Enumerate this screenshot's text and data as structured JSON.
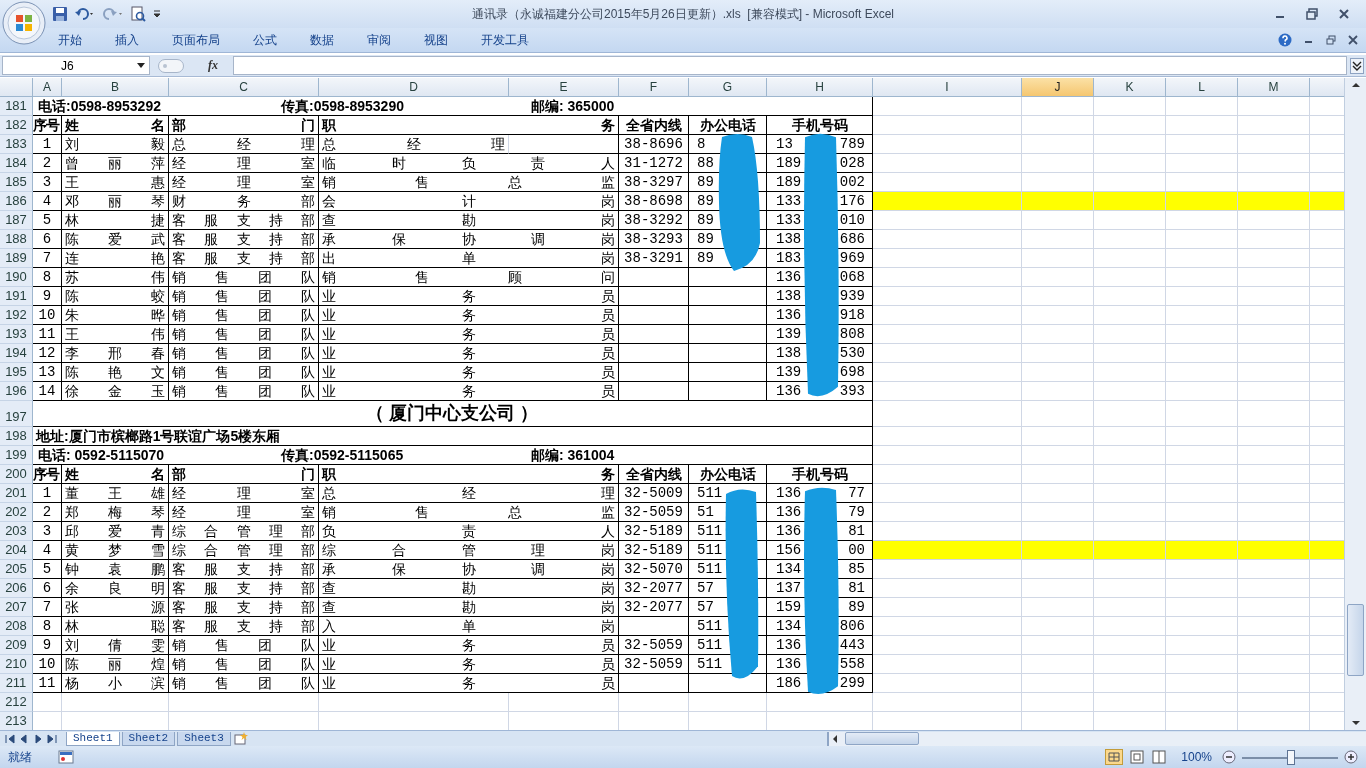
{
  "window": {
    "title": "通讯录（永诚福建分公司2015年5月26日更新）.xls  [兼容模式] - Microsoft Excel"
  },
  "ribbon_tabs": [
    "开始",
    "插入",
    "页面布局",
    "公式",
    "数据",
    "审阅",
    "视图",
    "开发工具"
  ],
  "formula_bar": {
    "name_box": "J6",
    "fx": "fx"
  },
  "columns": [
    {
      "label": "A",
      "selected": false
    },
    {
      "label": "B",
      "selected": false
    },
    {
      "label": "C",
      "selected": false
    },
    {
      "label": "D",
      "selected": false
    },
    {
      "label": "E",
      "selected": false
    },
    {
      "label": "F",
      "selected": false
    },
    {
      "label": "G",
      "selected": false
    },
    {
      "label": "H",
      "selected": false
    },
    {
      "label": "I",
      "selected": false
    },
    {
      "label": "J",
      "selected": true
    },
    {
      "label": "K",
      "selected": false
    },
    {
      "label": "L",
      "selected": false
    },
    {
      "label": "M",
      "selected": false
    }
  ],
  "rows": [
    {
      "kind": "contact",
      "number": "181",
      "phone": "电话:0598-8953292",
      "fax": "传真:0598-8953290",
      "postcode": "邮编: 365000"
    },
    {
      "kind": "header",
      "number": "182",
      "index": "序号",
      "name": "姓名",
      "department": "部门",
      "position": "职务",
      "line": "全省内线",
      "office": "办公电话",
      "mobile": "手机号码"
    },
    {
      "kind": "person",
      "number": "183",
      "index": "1",
      "name": "刘毅",
      "department": "总经理",
      "position": "总经理",
      "position_wide": false,
      "line": "38-8696",
      "office": "8",
      "mobile_start": "13",
      "mobile_end": "789",
      "highlight": false
    },
    {
      "kind": "person",
      "number": "184",
      "index": "2",
      "name": "曾丽萍",
      "department": "经理室",
      "position": "临时负责人",
      "position_wide": true,
      "line": "31-1272",
      "office": "88",
      "mobile_start": "189",
      "mobile_end": "028",
      "highlight": false
    },
    {
      "kind": "person",
      "number": "185",
      "index": "3",
      "name": "王惠",
      "department": "经理室",
      "position": "销售总监",
      "position_wide": true,
      "line": "38-3297",
      "office": "89",
      "mobile_start": "189",
      "mobile_end": "002",
      "highlight": false
    },
    {
      "kind": "person",
      "number": "186",
      "index": "4",
      "name": "邓丽琴",
      "department": "财务部",
      "position": "会计岗",
      "position_wide": true,
      "line": "38-8698",
      "office": "89",
      "mobile_start": "133",
      "mobile_end": "176",
      "highlight": true
    },
    {
      "kind": "person",
      "number": "187",
      "index": "5",
      "name": "林捷",
      "department": "客服支持部",
      "position": "查勘岗",
      "position_wide": true,
      "line": "38-3292",
      "office": "89",
      "mobile_start": "133",
      "mobile_end": "010",
      "highlight": false
    },
    {
      "kind": "person",
      "number": "188",
      "index": "6",
      "name": "陈爱武",
      "department": "客服支持部",
      "position": "承保协调岗",
      "position_wide": true,
      "line": "38-3293",
      "office": "89",
      "mobile_start": "138",
      "mobile_end": "686",
      "highlight": false
    },
    {
      "kind": "person",
      "number": "189",
      "index": "7",
      "name": "连艳",
      "department": "客服支持部",
      "position": "出单岗",
      "position_wide": true,
      "line": "38-3291",
      "office": "89",
      "mobile_start": "183",
      "mobile_end": "969",
      "highlight": false
    },
    {
      "kind": "person",
      "number": "190",
      "index": "8",
      "name": "苏伟",
      "department": "销售团队",
      "position": "销售顾问",
      "position_wide": true,
      "mobile_start": "136",
      "mobile_end": "068",
      "highlight": false
    },
    {
      "kind": "person",
      "number": "191",
      "index": "9",
      "name": "陈蛟",
      "department": "销售团队",
      "position": "业务员",
      "position_wide": true,
      "mobile_start": "138",
      "mobile_end": "939",
      "highlight": false
    },
    {
      "kind": "person",
      "number": "192",
      "index": "10",
      "name": "朱晔",
      "department": "销售团队",
      "position": "业务员",
      "position_wide": true,
      "mobile_start": "136",
      "mobile_end": "918",
      "highlight": false
    },
    {
      "kind": "person",
      "number": "193",
      "index": "11",
      "name": "王伟",
      "department": "销售团队",
      "position": "业务员",
      "position_wide": true,
      "mobile_start": "139",
      "mobile_end": "808",
      "highlight": false
    },
    {
      "kind": "person",
      "number": "194",
      "index": "12",
      "name": "李邢春",
      "department": "销售团队",
      "position": "业务员",
      "position_wide": true,
      "mobile_start": "138",
      "mobile_end": "530",
      "highlight": false
    },
    {
      "kind": "person",
      "number": "195",
      "index": "13",
      "name": "陈艳文",
      "department": "销售团队",
      "position": "业务员",
      "position_wide": true,
      "mobile_start": "139",
      "mobile_end": "698",
      "highlight": false
    },
    {
      "kind": "person",
      "number": "196",
      "index": "14",
      "name": "徐金玉",
      "department": "销售团队",
      "position": "业务员",
      "position_wide": true,
      "mobile_start": "136",
      "mobile_end": "393",
      "highlight": false
    },
    {
      "kind": "branch",
      "number": "197",
      "title": "（ 厦门中心支公司 ）"
    },
    {
      "kind": "address",
      "number": "198",
      "address": "地址:厦门市槟榔路1号联谊广场5楼东厢"
    },
    {
      "kind": "contact",
      "number": "199",
      "phone": "电话:  0592-5115070",
      "fax": "传真:0592-5115065",
      "postcode": "邮编: 361004"
    },
    {
      "kind": "header",
      "number": "200",
      "index": "序号",
      "name": "姓名",
      "department": "部门",
      "position": "职务",
      "line": "全省内线",
      "office": "办公电话",
      "mobile": "手机号码"
    },
    {
      "kind": "person",
      "number": "201",
      "index": "1",
      "name": "董王雄",
      "department": "经理室",
      "position": "总经理",
      "position_wide": true,
      "line": "32-5009",
      "office": "511",
      "mobile_start": "136",
      "mobile_end": "77",
      "highlight": false
    },
    {
      "kind": "person",
      "number": "202",
      "index": "2",
      "name": "郑梅琴",
      "department": "经理室",
      "position": "销售总监",
      "position_wide": true,
      "line": "32-5059",
      "office": "51",
      "mobile_start": "136",
      "mobile_end": "79",
      "highlight": false
    },
    {
      "kind": "person",
      "number": "203",
      "index": "3",
      "name": "邱爱青",
      "department": "综合管理部",
      "position": "负责人",
      "position_wide": true,
      "line": "32-5189",
      "office": "511",
      "mobile_start": "136",
      "mobile_end": "81",
      "highlight": false
    },
    {
      "kind": "person",
      "number": "204",
      "index": "4",
      "name": "黄梦雪",
      "department": "综合管理部",
      "position": "综合管理岗",
      "position_wide": true,
      "line": "32-5189",
      "office": "511",
      "mobile_start": "156",
      "mobile_end": "00",
      "highlight": true
    },
    {
      "kind": "person",
      "number": "205",
      "index": "5",
      "name": "钟袁鹏",
      "department": "客服支持部",
      "position": "承保协调岗",
      "position_wide": true,
      "line": "32-5070",
      "office": "511",
      "mobile_start": "134",
      "mobile_end": "85",
      "highlight": false
    },
    {
      "kind": "person",
      "number": "206",
      "index": "6",
      "name": "余良明",
      "department": "客服支持部",
      "position": "查勘岗",
      "position_wide": true,
      "line": "32-2077",
      "office": "57",
      "mobile_start": "137",
      "mobile_end": "81",
      "highlight": false
    },
    {
      "kind": "person",
      "number": "207",
      "index": "7",
      "name": "张源",
      "department": "客服支持部",
      "position": "查勘岗",
      "position_wide": true,
      "line": "32-2077",
      "office": "57",
      "mobile_start": "159",
      "mobile_end": "89",
      "highlight": false
    },
    {
      "kind": "person",
      "number": "208",
      "index": "8",
      "name": "林聪",
      "department": "客服支持部",
      "position": "入单岗",
      "position_wide": true,
      "office": "511",
      "mobile_start": "134",
      "mobile_end": "806",
      "highlight": false
    },
    {
      "kind": "person",
      "number": "209",
      "index": "9",
      "name": "刘倩雯",
      "department": "销售团队",
      "position": "业务员",
      "position_wide": true,
      "line": "32-5059",
      "office": "511",
      "mobile_start": "136",
      "mobile_end": "443",
      "highlight": false
    },
    {
      "kind": "person",
      "number": "210",
      "index": "10",
      "name": "陈丽煌",
      "department": "销售团队",
      "position": "业务员",
      "position_wide": true,
      "line": "32-5059",
      "office": "511",
      "mobile_start": "136",
      "mobile_end": "558",
      "highlight": false
    },
    {
      "kind": "person",
      "number": "211",
      "index": "11",
      "name": "杨小滨",
      "department": "销售团队",
      "position": "业务员",
      "position_wide": true,
      "mobile_start": "186",
      "mobile_end": "299",
      "highlight": false
    },
    {
      "kind": "blank",
      "number": "212"
    },
    {
      "kind": "blank",
      "number": "213"
    }
  ],
  "sheet_tabs": [
    {
      "label": "Sheet1",
      "selected": true
    },
    {
      "label": "Sheet2",
      "selected": false
    },
    {
      "label": "Sheet3",
      "selected": false
    }
  ],
  "status_bar": {
    "status": "就绪",
    "zoom": "100%",
    "zoom_slider": {
      "level": 0.5
    }
  }
}
